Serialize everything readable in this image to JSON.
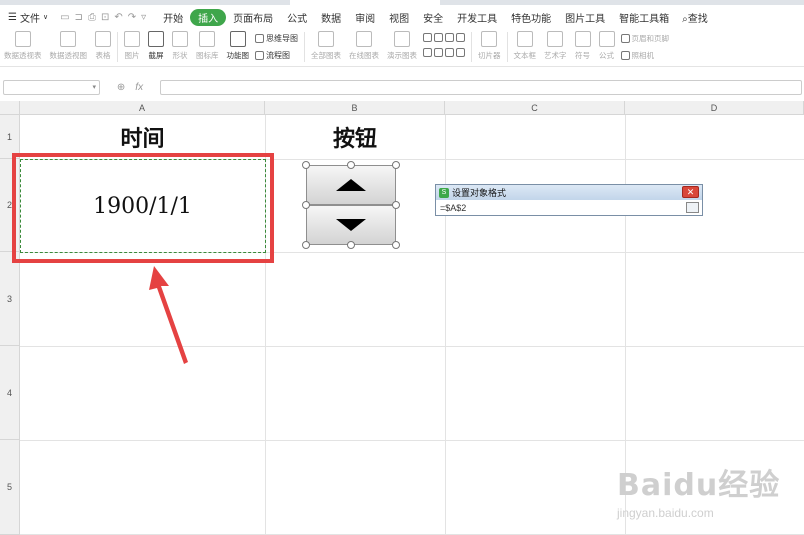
{
  "menubar": {
    "file_label": "文件",
    "tabs": [
      "开始",
      "插入",
      "页面布局",
      "公式",
      "数据",
      "审阅",
      "视图",
      "安全",
      "开发工具",
      "特色功能",
      "图片工具",
      "智能工具箱"
    ],
    "active_tab": "插入",
    "search_label": "查找"
  },
  "ribbon": {
    "pivot_table": "数据透视表",
    "pivot_chart": "数据透视图",
    "table": "表格",
    "picture": "图片",
    "screenshot": "截屏",
    "shapes": "形状",
    "icon_library": "图标库",
    "function_chart": "功能图",
    "mindmap": "思维导图",
    "flowchart": "流程图",
    "all_charts": "全部图表",
    "online_charts": "在线图表",
    "presentation_charts": "演示图表",
    "slicer": "切片器",
    "textbox": "文本框",
    "wordart": "艺术字",
    "symbol": "符号",
    "formula": "公式",
    "header_footer": "页眉和页脚",
    "camera": "照相机"
  },
  "formula_bar": {
    "fx": "fx",
    "formula": ""
  },
  "grid": {
    "columns": [
      "A",
      "B",
      "C",
      "D"
    ],
    "rows": [
      "1",
      "2",
      "3",
      "4",
      "5"
    ],
    "a1": "时间",
    "b1": "按钮",
    "a2": "1900/1/1"
  },
  "dialog": {
    "title": "设置对象格式",
    "value": "=$A$2",
    "logo": "S",
    "close": "✕"
  },
  "watermark": {
    "logo": "Baidu经验",
    "url": "jingyan.baidu.com"
  },
  "colors": {
    "highlight": "#e54242",
    "accent": "#3fa64b"
  }
}
